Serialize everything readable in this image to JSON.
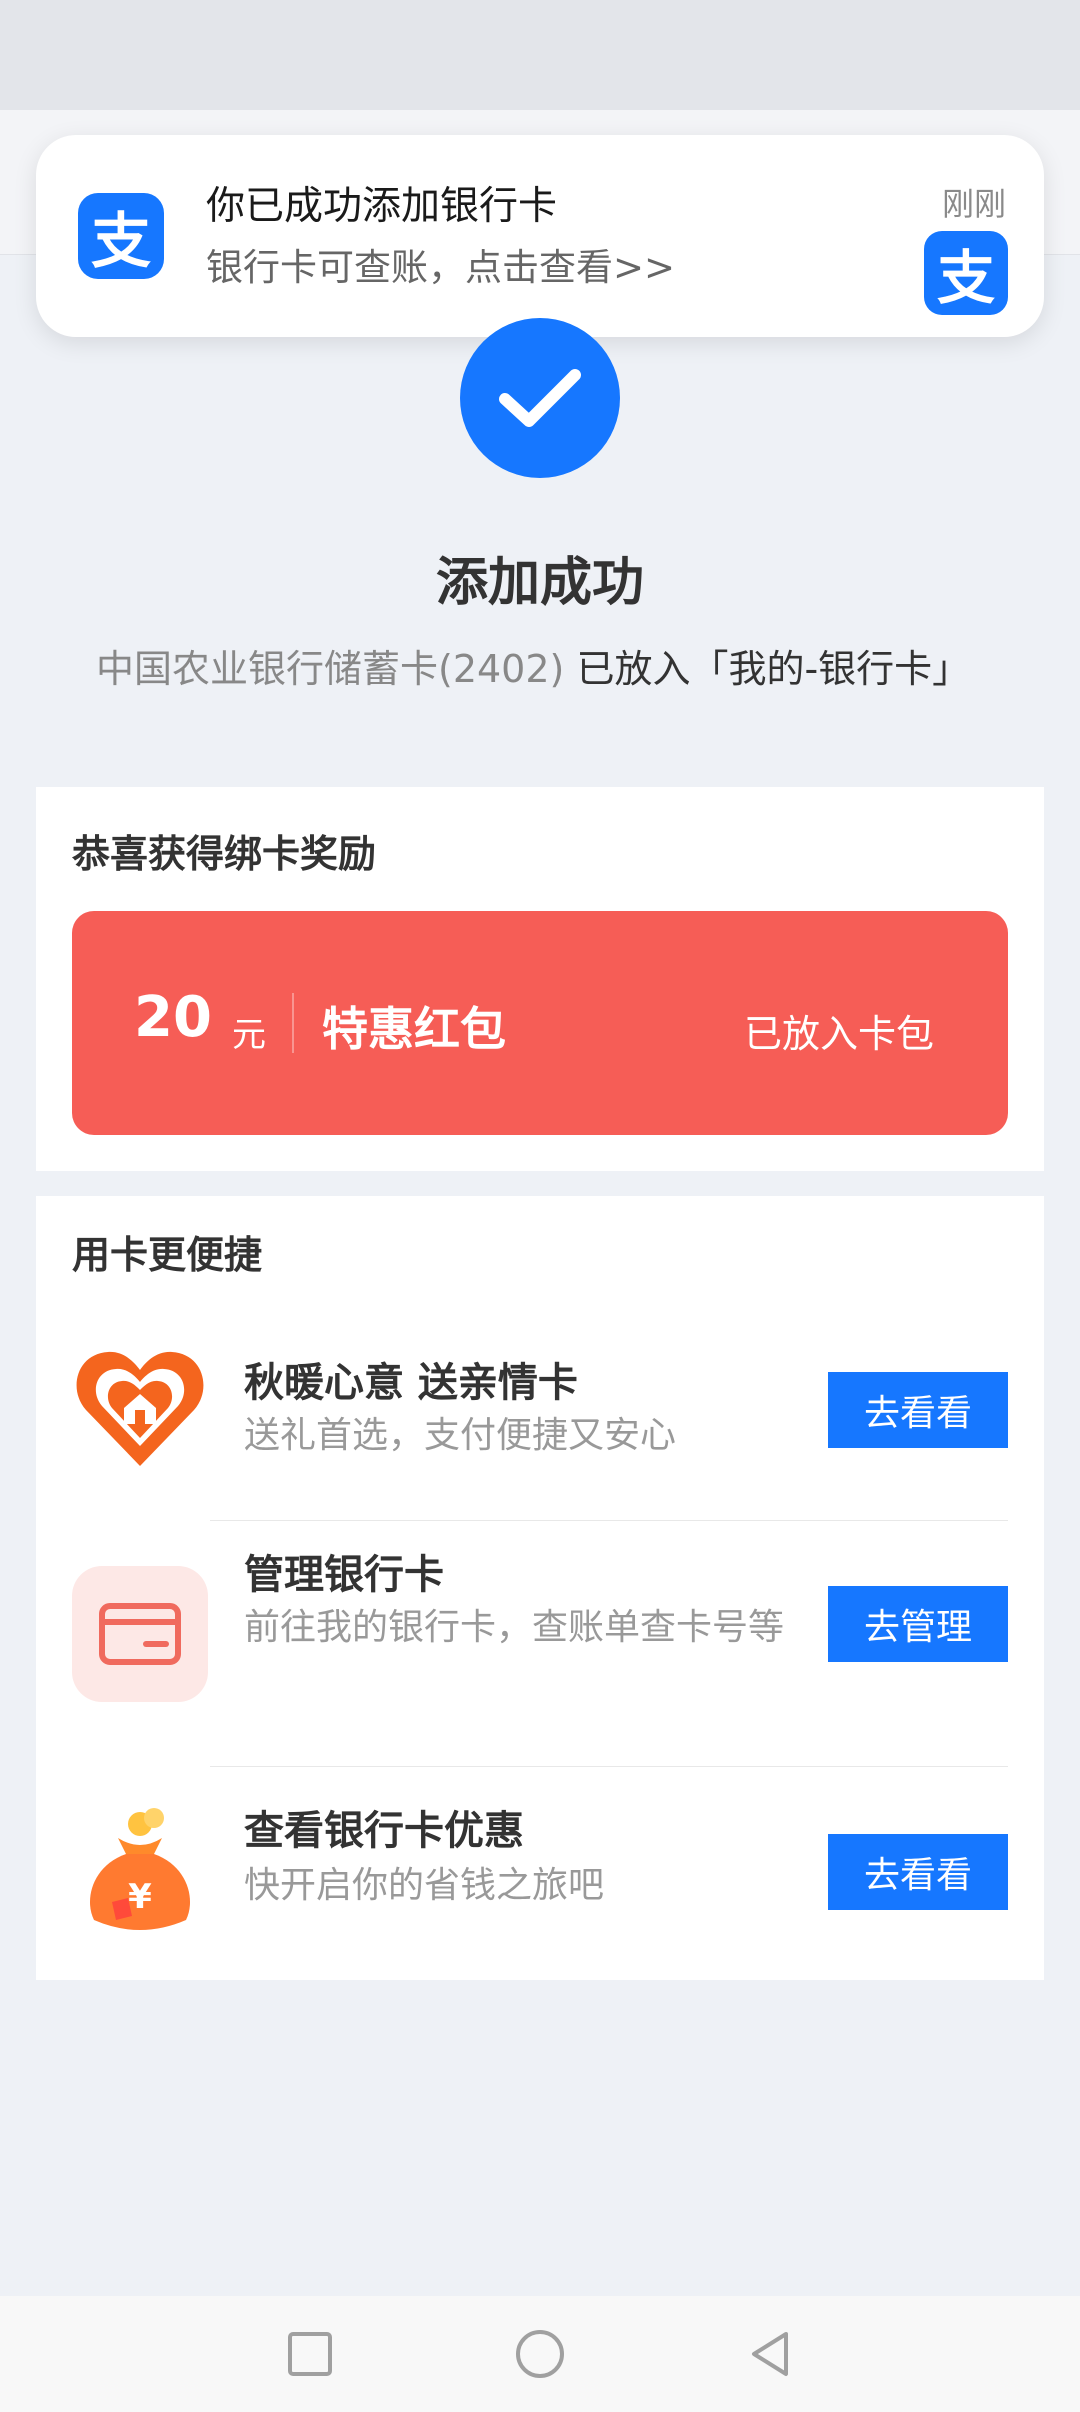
{
  "notification": {
    "app_icon": "alipay-icon",
    "title": "你已成功添加银行卡",
    "body": "银行卡可查账，点击查看>>",
    "time": "刚刚"
  },
  "success": {
    "icon": "check-icon",
    "title": "添加成功",
    "bank_card": "中国农业银行储蓄卡(2402)",
    "placed_text": "已放入「我的-银行卡」"
  },
  "reward": {
    "heading": "恭喜获得绑卡奖励",
    "amount": "20",
    "unit": "元",
    "name": "特惠红包",
    "status": "已放入卡包"
  },
  "tools": {
    "heading": "用卡更便捷",
    "items": [
      {
        "icon": "heart-home-icon",
        "title": "秋暖心意 送亲情卡",
        "desc": "送礼首选，支付便捷又安心",
        "button": "去看看"
      },
      {
        "icon": "bank-card-icon",
        "title": "管理银行卡",
        "desc": "前往我的银行卡，查账单查卡号等",
        "button": "去管理"
      },
      {
        "icon": "money-bag-icon",
        "title": "查看银行卡优惠",
        "desc": "快开启你的省钱之旅吧",
        "button": "去看看"
      }
    ]
  },
  "colors": {
    "primary": "#1677ff",
    "red_packet": "#f65d56",
    "background": "#eef1f6"
  },
  "nav": {
    "items": [
      "recents-icon",
      "home-icon",
      "back-icon"
    ]
  }
}
